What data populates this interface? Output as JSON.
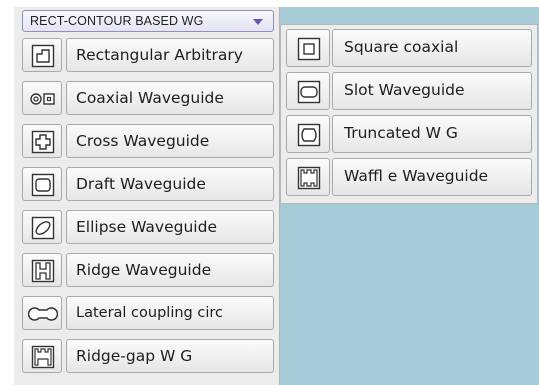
{
  "dropdown": {
    "value": "RECT-CONTOUR BASED WG"
  },
  "menu": {
    "items": [
      {
        "label": "Rectangular Arbitrary",
        "icon": "rectangular-arbitrary-icon"
      },
      {
        "label": "Coaxial Waveguide",
        "icon": "coaxial-icon"
      },
      {
        "label": "Cross Waveguide",
        "icon": "cross-icon"
      },
      {
        "label": "Draft Waveguide",
        "icon": "draft-icon"
      },
      {
        "label": "Ellipse Waveguide",
        "icon": "ellipse-icon"
      },
      {
        "label": "Ridge Waveguide",
        "icon": "ridge-icon"
      },
      {
        "label": "Lateral coupling circ",
        "icon": "lateral-coupling-icon"
      },
      {
        "label": "Ridge-gap W G",
        "icon": "ridge-gap-icon"
      }
    ]
  },
  "submenu": {
    "items": [
      {
        "label": "Square coaxial",
        "icon": "square-coaxial-icon"
      },
      {
        "label": "Slot Waveguide",
        "icon": "slot-icon"
      },
      {
        "label": "Truncated W G",
        "icon": "truncated-icon"
      },
      {
        "label": "Waffl e Waveguide",
        "icon": "waffle-icon"
      }
    ]
  },
  "colors": {
    "background": "#a8cbd8",
    "panel": "#ececec",
    "button_border": "#a9a9a9",
    "dropdown_border": "#8f8fb8",
    "dropdown_arrow": "#5c5caa"
  }
}
